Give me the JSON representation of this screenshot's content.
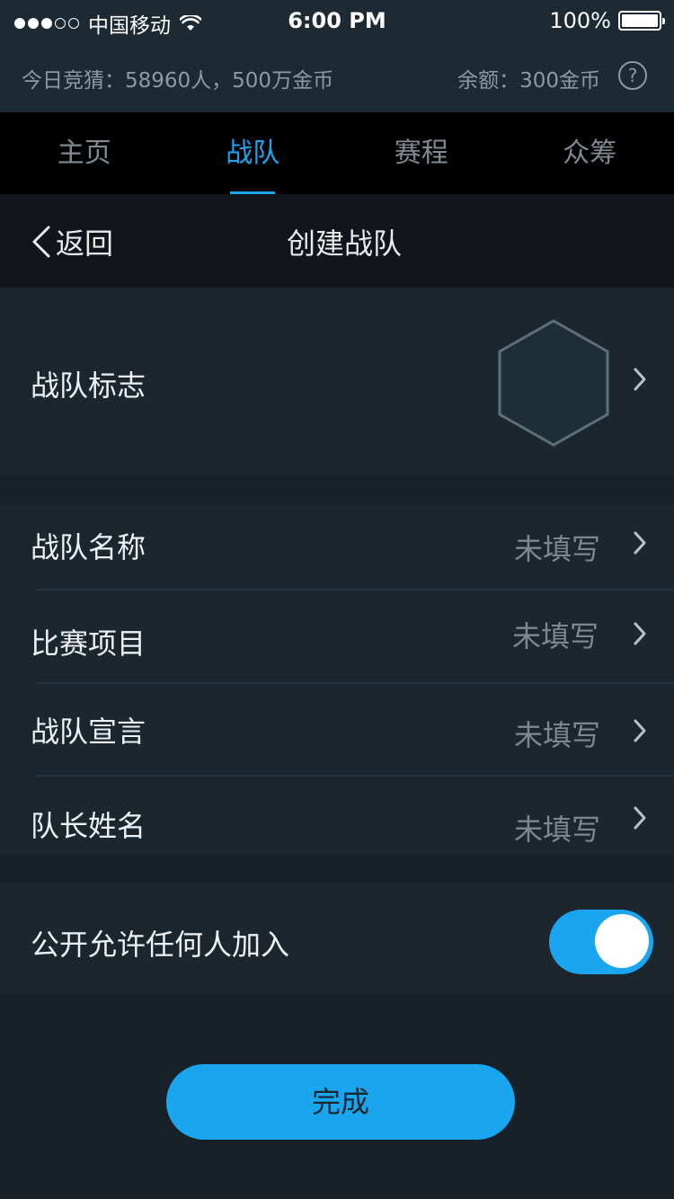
{
  "status_bar": {
    "carrier": "中国移动",
    "time": "6:00 PM",
    "battery": "100%"
  },
  "info_bar": {
    "today_guess": "今日竞猜：58960人，500万金币",
    "balance": "余额：300金币",
    "help_symbol": "?"
  },
  "tabs": [
    {
      "label": "主页",
      "active": false
    },
    {
      "label": "战队",
      "active": true
    },
    {
      "label": "赛程",
      "active": false
    },
    {
      "label": "众筹",
      "active": false
    }
  ],
  "nav": {
    "back_label": "返回",
    "title": "创建战队"
  },
  "logo_row": {
    "label": "战队标志"
  },
  "form_rows": [
    {
      "label": "战队名称",
      "value": "未填写"
    },
    {
      "label": "比赛项目",
      "value": "未填写"
    },
    {
      "label": "战队宣言",
      "value": "未填写"
    },
    {
      "label": "队长姓名",
      "value": "未填写"
    }
  ],
  "public_toggle": {
    "label": "公开允许任何人加入",
    "on": true
  },
  "done_button": {
    "label": "完成"
  },
  "colors": {
    "accent": "#19a6ee",
    "background": "#16212a",
    "section": "#1b262e",
    "tab_bar": "#000000"
  },
  "icons": [
    "signal-dots-icon",
    "wifi-icon",
    "battery-icon",
    "help-icon",
    "back-chevron-icon",
    "hexagon-placeholder-icon",
    "chevron-right-icon"
  ]
}
